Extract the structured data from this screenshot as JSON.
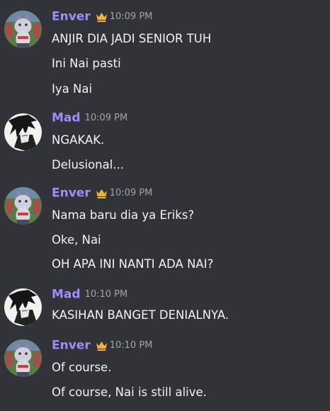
{
  "messages": [
    {
      "author": "Enver",
      "time": "10:09 PM",
      "crown": true,
      "avatar": "cat-avatar-icon",
      "lines": [
        "ANJIR DIA JADI SENIOR TUH",
        "Ini Nai pasti",
        "Iya Nai"
      ]
    },
    {
      "author": "Mad",
      "time": "10:09 PM",
      "crown": false,
      "avatar": "anime-sketch-avatar-icon",
      "lines": [
        "NGAKAK.",
        "Delusional..."
      ]
    },
    {
      "author": "Enver",
      "time": "10:09 PM",
      "crown": true,
      "avatar": "cat-avatar-icon",
      "lines": [
        "Nama baru dia ya Eriks?",
        "Oke, Nai",
        "OH APA INI NANTI ADA NAI?"
      ]
    },
    {
      "author": "Mad",
      "time": "10:10 PM",
      "crown": false,
      "avatar": "anime-sketch-avatar-icon",
      "lines": [
        "KASIHAN BANGET DENIALNYA."
      ]
    },
    {
      "author": "Enver",
      "time": "10:10 PM",
      "crown": true,
      "avatar": "cat-avatar-icon",
      "lines": [
        "Of course.",
        "Of course, Nai is still alive."
      ]
    }
  ],
  "colors": {
    "background": "#313338",
    "username": "#a08df7",
    "crown": "#f0b232",
    "timestamp": "#a0a3a9",
    "message_text": "#f2f3f5"
  }
}
